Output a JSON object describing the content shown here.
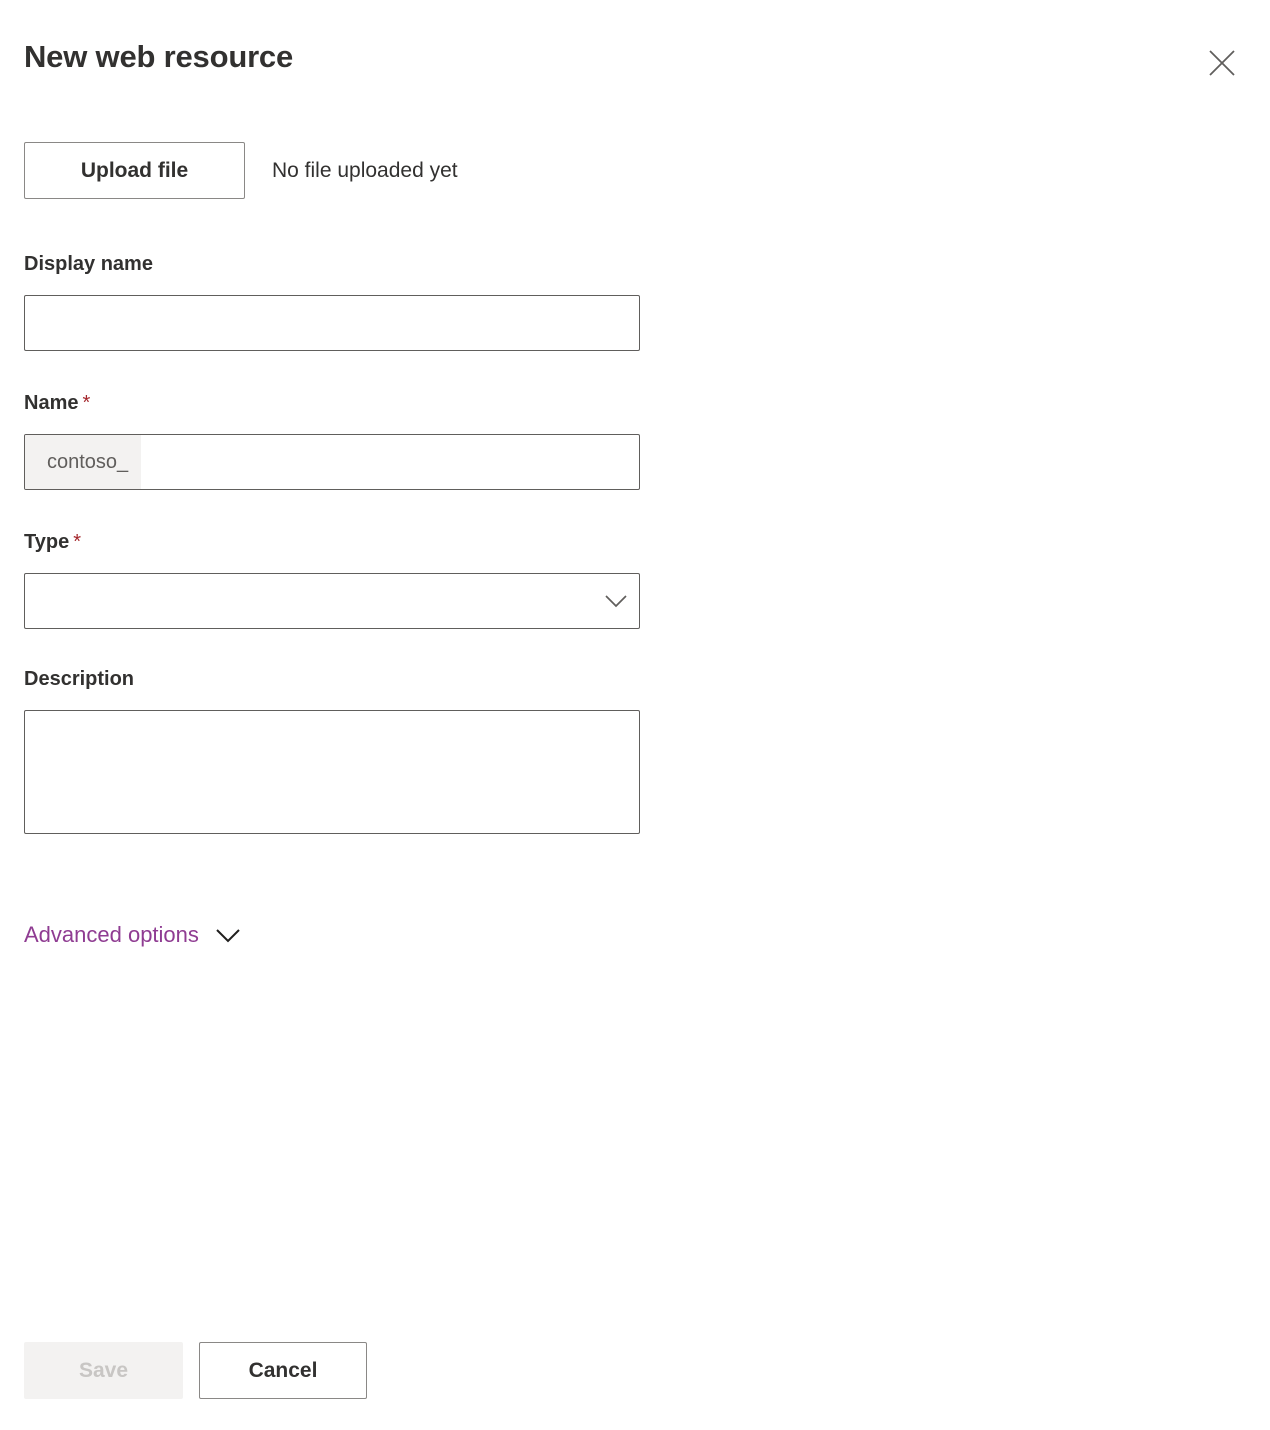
{
  "panel": {
    "title": "New web resource",
    "close_icon": "close-icon"
  },
  "upload": {
    "button_label": "Upload file",
    "status_text": "No file uploaded yet"
  },
  "form": {
    "display_name": {
      "label": "Display name",
      "value": "",
      "placeholder": ""
    },
    "name": {
      "label": "Name",
      "required_marker": "*",
      "prefix": "contoso_",
      "value": "",
      "placeholder": ""
    },
    "type": {
      "label": "Type",
      "required_marker": "*",
      "selected": "",
      "chevron_icon": "chevron-down-icon"
    },
    "description": {
      "label": "Description",
      "value": "",
      "placeholder": ""
    }
  },
  "advanced": {
    "label": "Advanced options",
    "chevron_icon": "chevron-down-icon"
  },
  "footer": {
    "save_label": "Save",
    "cancel_label": "Cancel"
  },
  "colors": {
    "required_red": "#a4262c",
    "link_purple": "#8f3c92",
    "text_primary": "#323130",
    "border_strong": "#605e5c",
    "border_button": "#8a8886",
    "disabled_bg": "#f3f2f1",
    "disabled_text": "#c8c6c4",
    "prefix_bg": "#f3f2f1"
  }
}
